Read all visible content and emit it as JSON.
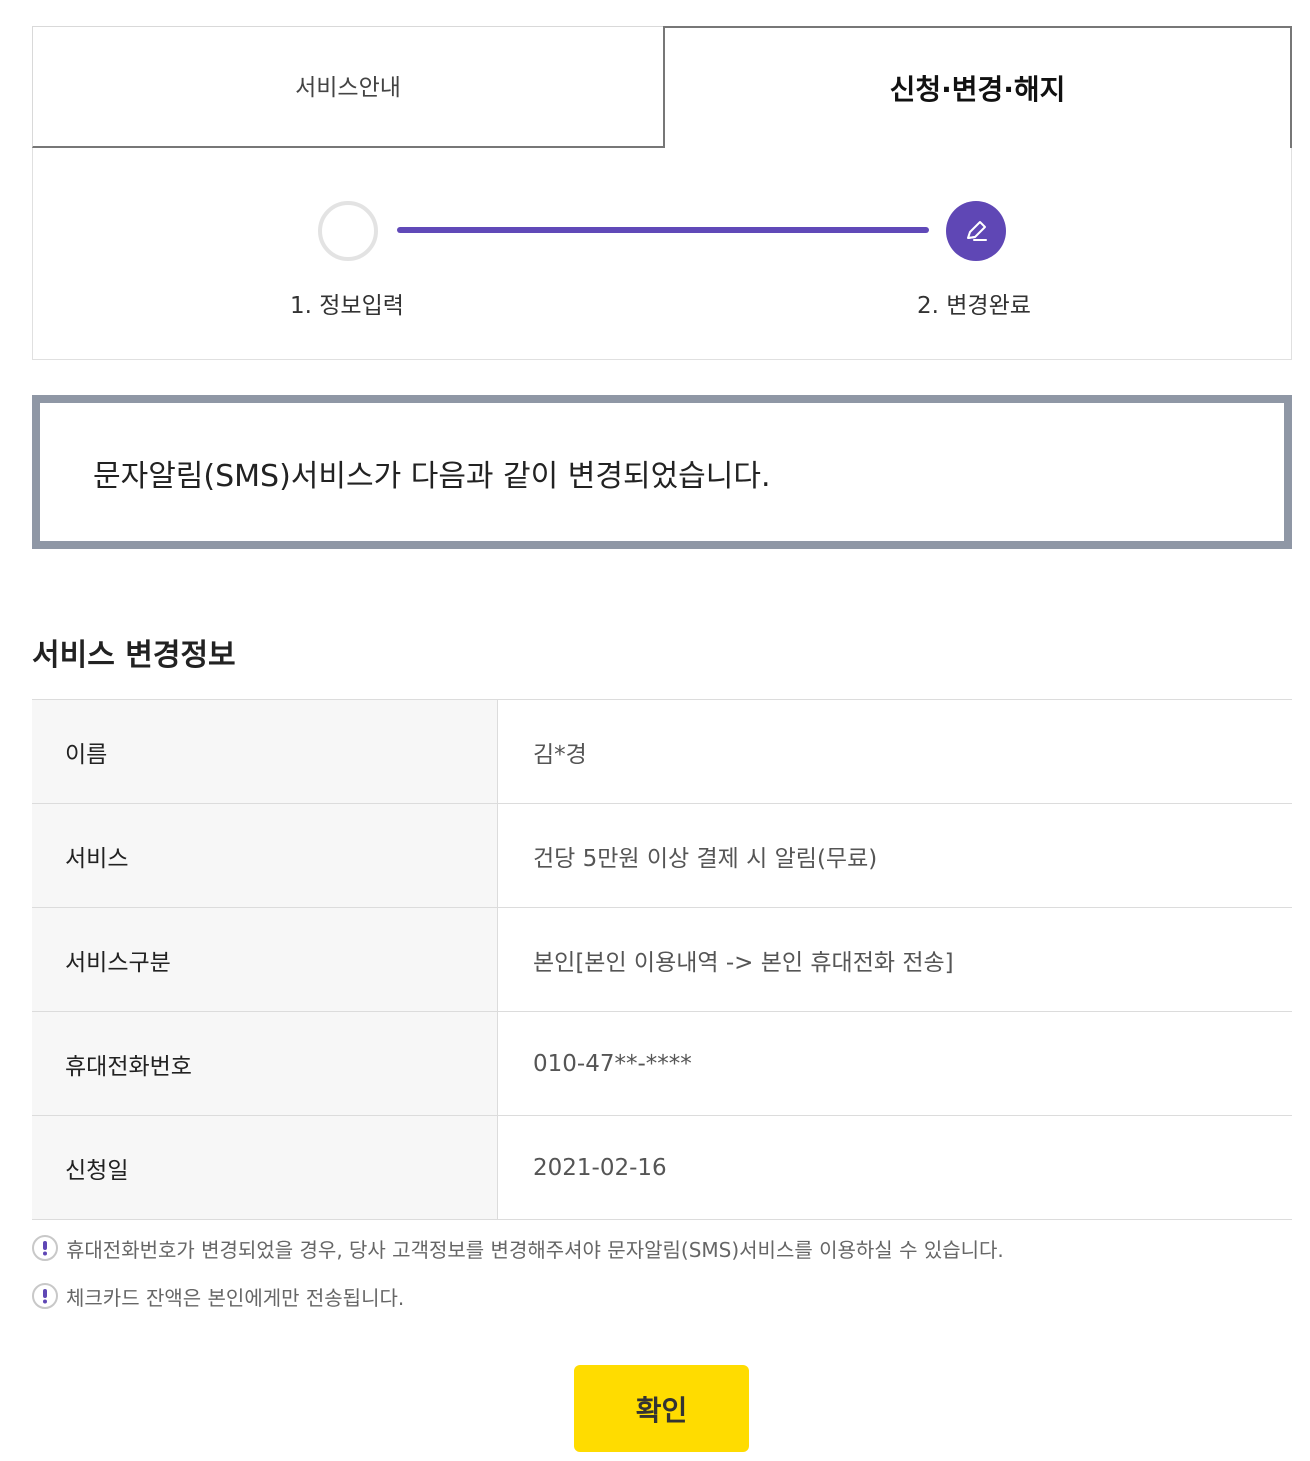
{
  "tabs": {
    "left_label": "서비스안내",
    "right_label": "신청·변경·해지"
  },
  "steps": {
    "step1_label": "1. 정보입력",
    "step2_label": "2. 변경완료",
    "step2_icon": "pencil-icon",
    "accent_color": "#5f47b5"
  },
  "notice": {
    "message": "문자알림(SMS)서비스가 다음과 같이 변경되었습니다."
  },
  "section": {
    "title": "서비스 변경정보"
  },
  "table": {
    "rows": [
      {
        "label": "이름",
        "value": "김*경"
      },
      {
        "label": "서비스",
        "value": "건당 5만원 이상 결제 시 알림(무료)"
      },
      {
        "label": "서비스구분",
        "value": "본인[본인 이용내역 -> 본인 휴대전화 전송]"
      },
      {
        "label": "휴대전화번호",
        "value": "010-47**-****"
      },
      {
        "label": "신청일",
        "value": "2021-02-16"
      }
    ]
  },
  "notes": [
    {
      "icon": "exclamation-icon",
      "text": "휴대전화번호가 변경되었을 경우, 당사 고객정보를 변경해주셔야 문자알림(SMS)서비스를 이용하실 수 있습니다."
    },
    {
      "icon": "exclamation-icon",
      "text": "체크카드 잔액은 본인에게만 전송됩니다."
    }
  ],
  "confirm_button": {
    "label": "확인",
    "color": "#ffdc00"
  }
}
